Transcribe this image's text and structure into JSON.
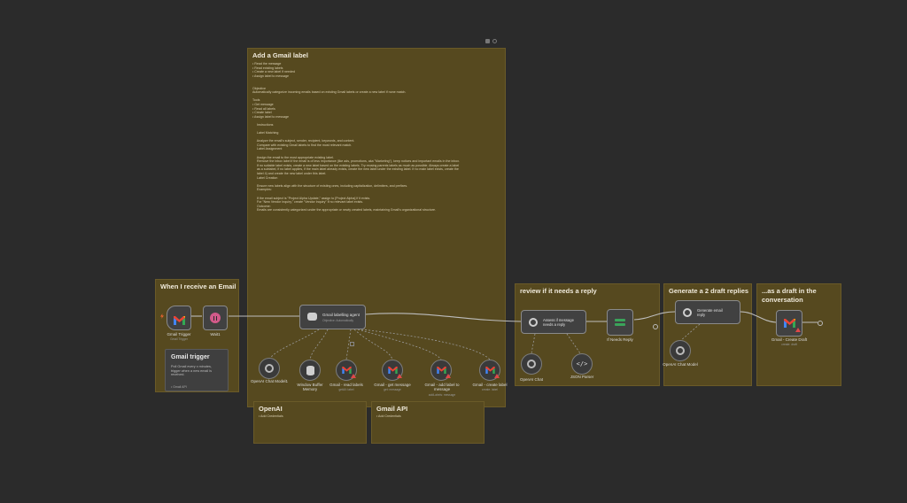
{
  "window": {
    "top_right_icons": [
      "pin-icon",
      "settings-icon"
    ]
  },
  "sticky_notes": {
    "main": {
      "title": "Add a Gmail label",
      "body": "• Read the message\n• Read existing labels\n• Create a new label if needed\n• Assign label to message\n\n\nObjective\nAutomatically categorize incoming emails based on existing Gmail labels or create a new label if none match.\n\nTools\n• Get message\n• Read all labels\n• Create label\n• Assign label to message\n\n     Instructions\n\n     Label Matching\n\n     Analyze the email's subject, sender, recipient, keywords, and content.\n     Compare with existing Gmail labels to find the most relevant match.\n     Label Assignment\n\n     Assign the email to the most appropriate existing label.\n     Remove the inbox label if the email is of less importance (like ads, promotions, aka \"Marketing\"), keep notices and important emails in the inbox.\n     If no suitable label exists, create a new label based on the existing labels. Try reusing parents labels as much as possible. Always create a label\n     as a subtabel, if no label applies, if the main label already exists, create the new label under the existing label. If no main label exists, create the\n     label 4) and create the new label under this label.\n     Label Creation\n\n     Ensure new labels align with the structure of existing ones, including capitalization, delimiters, and prefixes.\n     Examples:\n\n     If the email subject is \"Project Alpha Update,\" assign to [Project Alpha] if it exists.\n     For \"New Vendor Inquiry,\" create \"Vendor Inquiry\" if no relevant label exists.\n     Outcome:\n     Emails are consistently categorized under the appropriate or newly created labels, maintaining Gmail's organizational structure."
    },
    "receive": {
      "title": "When I receive an Email"
    },
    "reply": {
      "title": "review if it needs a reply"
    },
    "draft": {
      "title": "Generate a 2 draft replies"
    },
    "conversation": {
      "title": "...as a draft in the conversation"
    },
    "openai": {
      "title": "OpenAI",
      "body": "• Add Credentials"
    },
    "gmail_api": {
      "title": "Gmail API",
      "body": "• Add Credentials"
    }
  },
  "popup": {
    "title": "Gmail trigger",
    "body": "Poll Gmail every x minutes,\ntrigger when a new email is\nreceived.",
    "footer": "• Gmail API"
  },
  "nodes": {
    "gmail_trigger": {
      "label": "Gmail Trigger",
      "sub": "Gmail Trigger"
    },
    "wait": {
      "label": "Wait1"
    },
    "labelling_agent": {
      "label": "Gmail labelling agent",
      "sub": "Objective: Automatically"
    },
    "openai_model": {
      "label": "OpenAI Chat Model1"
    },
    "memory": {
      "label": "Window Buffer Memory"
    },
    "read_labels": {
      "label": "Gmail - read labels",
      "sub": "getAll: label"
    },
    "get_message": {
      "label": "Gmail - get message",
      "sub": "get: message"
    },
    "add_label": {
      "label": "Gmail - add label to message",
      "sub": "addLabels: message"
    },
    "create_label": {
      "label": "Gmail - create label",
      "sub": "create: label"
    },
    "assess": {
      "label": "Assess if message needs a reply"
    },
    "if_needs_reply": {
      "label": "If Needs Reply"
    },
    "openai_chat": {
      "label": "OpenAI Chat"
    },
    "json_parser": {
      "label": "JSON Parser"
    },
    "generate_reply": {
      "label": "Generate email reply"
    },
    "openai_chat_model": {
      "label": "OpenAI Chat Model"
    },
    "create_draft": {
      "label": "Gmail - Create Draft",
      "sub": "create: draft"
    }
  },
  "colors": {
    "background": "#2b2b2b",
    "sticky": "#56491f",
    "node": "#414141",
    "gmail_red": "#ea4335",
    "gmail_blue": "#4285f4",
    "gmail_green": "#34a853",
    "gmail_yellow": "#fbbc04",
    "if_green": "#3aa35a",
    "wait_pink": "#d35a8a",
    "warning": "#e04848"
  }
}
